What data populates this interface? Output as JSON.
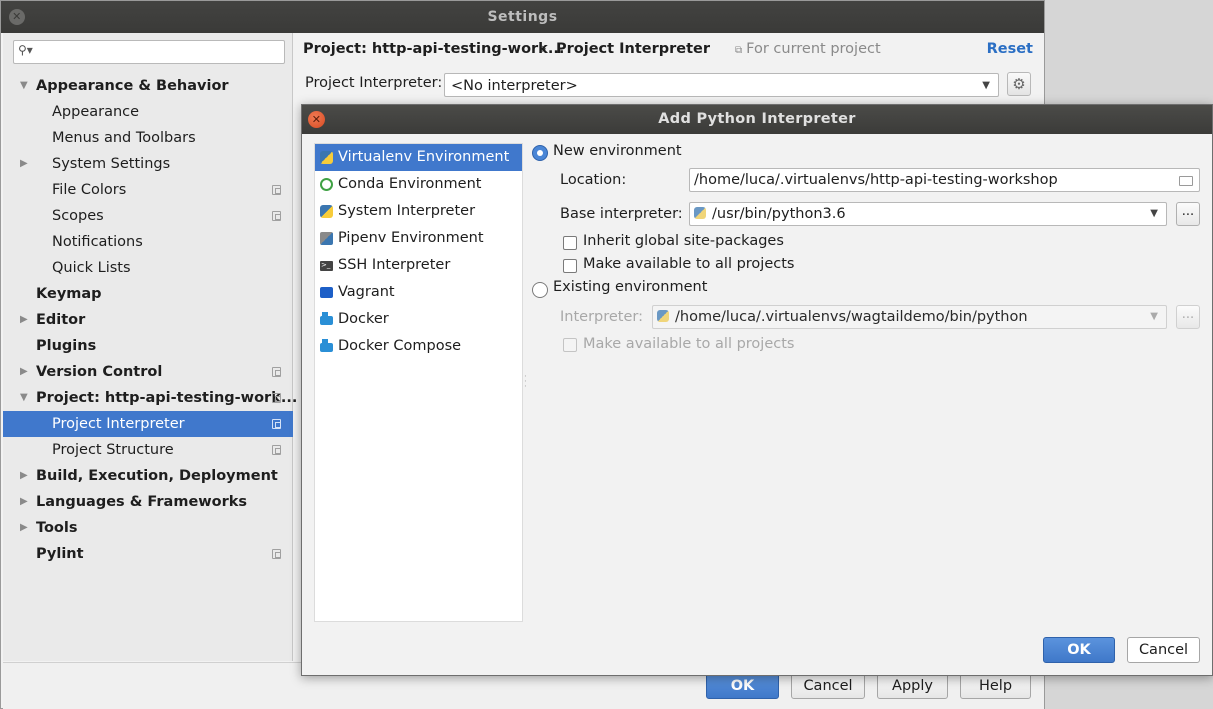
{
  "settings": {
    "title": "Settings",
    "search_placeholder": "",
    "tree": [
      {
        "label": "Appearance & Behavior",
        "level": 0,
        "arrow": "down",
        "copy": false
      },
      {
        "label": "Appearance",
        "level": 1,
        "arrow": "",
        "copy": false
      },
      {
        "label": "Menus and Toolbars",
        "level": 1,
        "arrow": "",
        "copy": false
      },
      {
        "label": "System Settings",
        "level": 1,
        "arrow": "right",
        "copy": false
      },
      {
        "label": "File Colors",
        "level": 1,
        "arrow": "",
        "copy": true
      },
      {
        "label": "Scopes",
        "level": 1,
        "arrow": "",
        "copy": true
      },
      {
        "label": "Notifications",
        "level": 1,
        "arrow": "",
        "copy": false
      },
      {
        "label": "Quick Lists",
        "level": 1,
        "arrow": "",
        "copy": false
      },
      {
        "label": "Keymap",
        "level": 0,
        "arrow": "",
        "copy": false
      },
      {
        "label": "Editor",
        "level": 0,
        "arrow": "right",
        "copy": false
      },
      {
        "label": "Plugins",
        "level": 0,
        "arrow": "",
        "copy": false
      },
      {
        "label": "Version Control",
        "level": 0,
        "arrow": "right",
        "copy": true
      },
      {
        "label": "Project: http-api-testing-work...",
        "level": 0,
        "arrow": "down",
        "copy": true
      },
      {
        "label": "Project Interpreter",
        "level": 1,
        "arrow": "",
        "copy": true,
        "selected": true
      },
      {
        "label": "Project Structure",
        "level": 1,
        "arrow": "",
        "copy": true
      },
      {
        "label": "Build, Execution, Deployment",
        "level": 0,
        "arrow": "right",
        "copy": false
      },
      {
        "label": "Languages & Frameworks",
        "level": 0,
        "arrow": "right",
        "copy": false
      },
      {
        "label": "Tools",
        "level": 0,
        "arrow": "right",
        "copy": false
      },
      {
        "label": "Pylint",
        "level": 0,
        "arrow": "",
        "copy": true
      }
    ],
    "breadcrumb": {
      "project": "Project: http-api-testing-work...",
      "separator": "›",
      "page": "Project Interpreter",
      "scope_note": "For current project",
      "reset": "Reset"
    },
    "interpreter": {
      "label": "Project Interpreter:",
      "value": "<No interpreter>"
    },
    "buttons": {
      "ok": "OK",
      "cancel": "Cancel",
      "apply": "Apply",
      "help": "Help"
    }
  },
  "dialog": {
    "title": "Add Python Interpreter",
    "environments": [
      {
        "label": "Virtualenv Environment",
        "icon": "virtualenv-icon",
        "selected": true
      },
      {
        "label": "Conda Environment",
        "icon": "conda-icon"
      },
      {
        "label": "System Interpreter",
        "icon": "python-icon"
      },
      {
        "label": "Pipenv Environment",
        "icon": "pipenv-icon"
      },
      {
        "label": "SSH Interpreter",
        "icon": "ssh-icon"
      },
      {
        "label": "Vagrant",
        "icon": "vagrant-icon"
      },
      {
        "label": "Docker",
        "icon": "docker-icon"
      },
      {
        "label": "Docker Compose",
        "icon": "docker-compose-icon"
      }
    ],
    "new_env": {
      "label": "New environment",
      "location_label": "Location:",
      "location_value": "/home/luca/.virtualenvs/http-api-testing-workshop",
      "base_label": "Base interpreter:",
      "base_value": "/usr/bin/python3.6",
      "browse": "...",
      "inherit_label": "Inherit global site-packages",
      "make_available_label": "Make available to all projects"
    },
    "existing_env": {
      "label": "Existing environment",
      "interpreter_label": "Interpreter:",
      "interpreter_value": "/home/luca/.virtualenvs/wagtaildemo/bin/python",
      "browse": "...",
      "make_available_label": "Make available to all projects"
    },
    "buttons": {
      "ok": "OK",
      "cancel": "Cancel"
    }
  }
}
